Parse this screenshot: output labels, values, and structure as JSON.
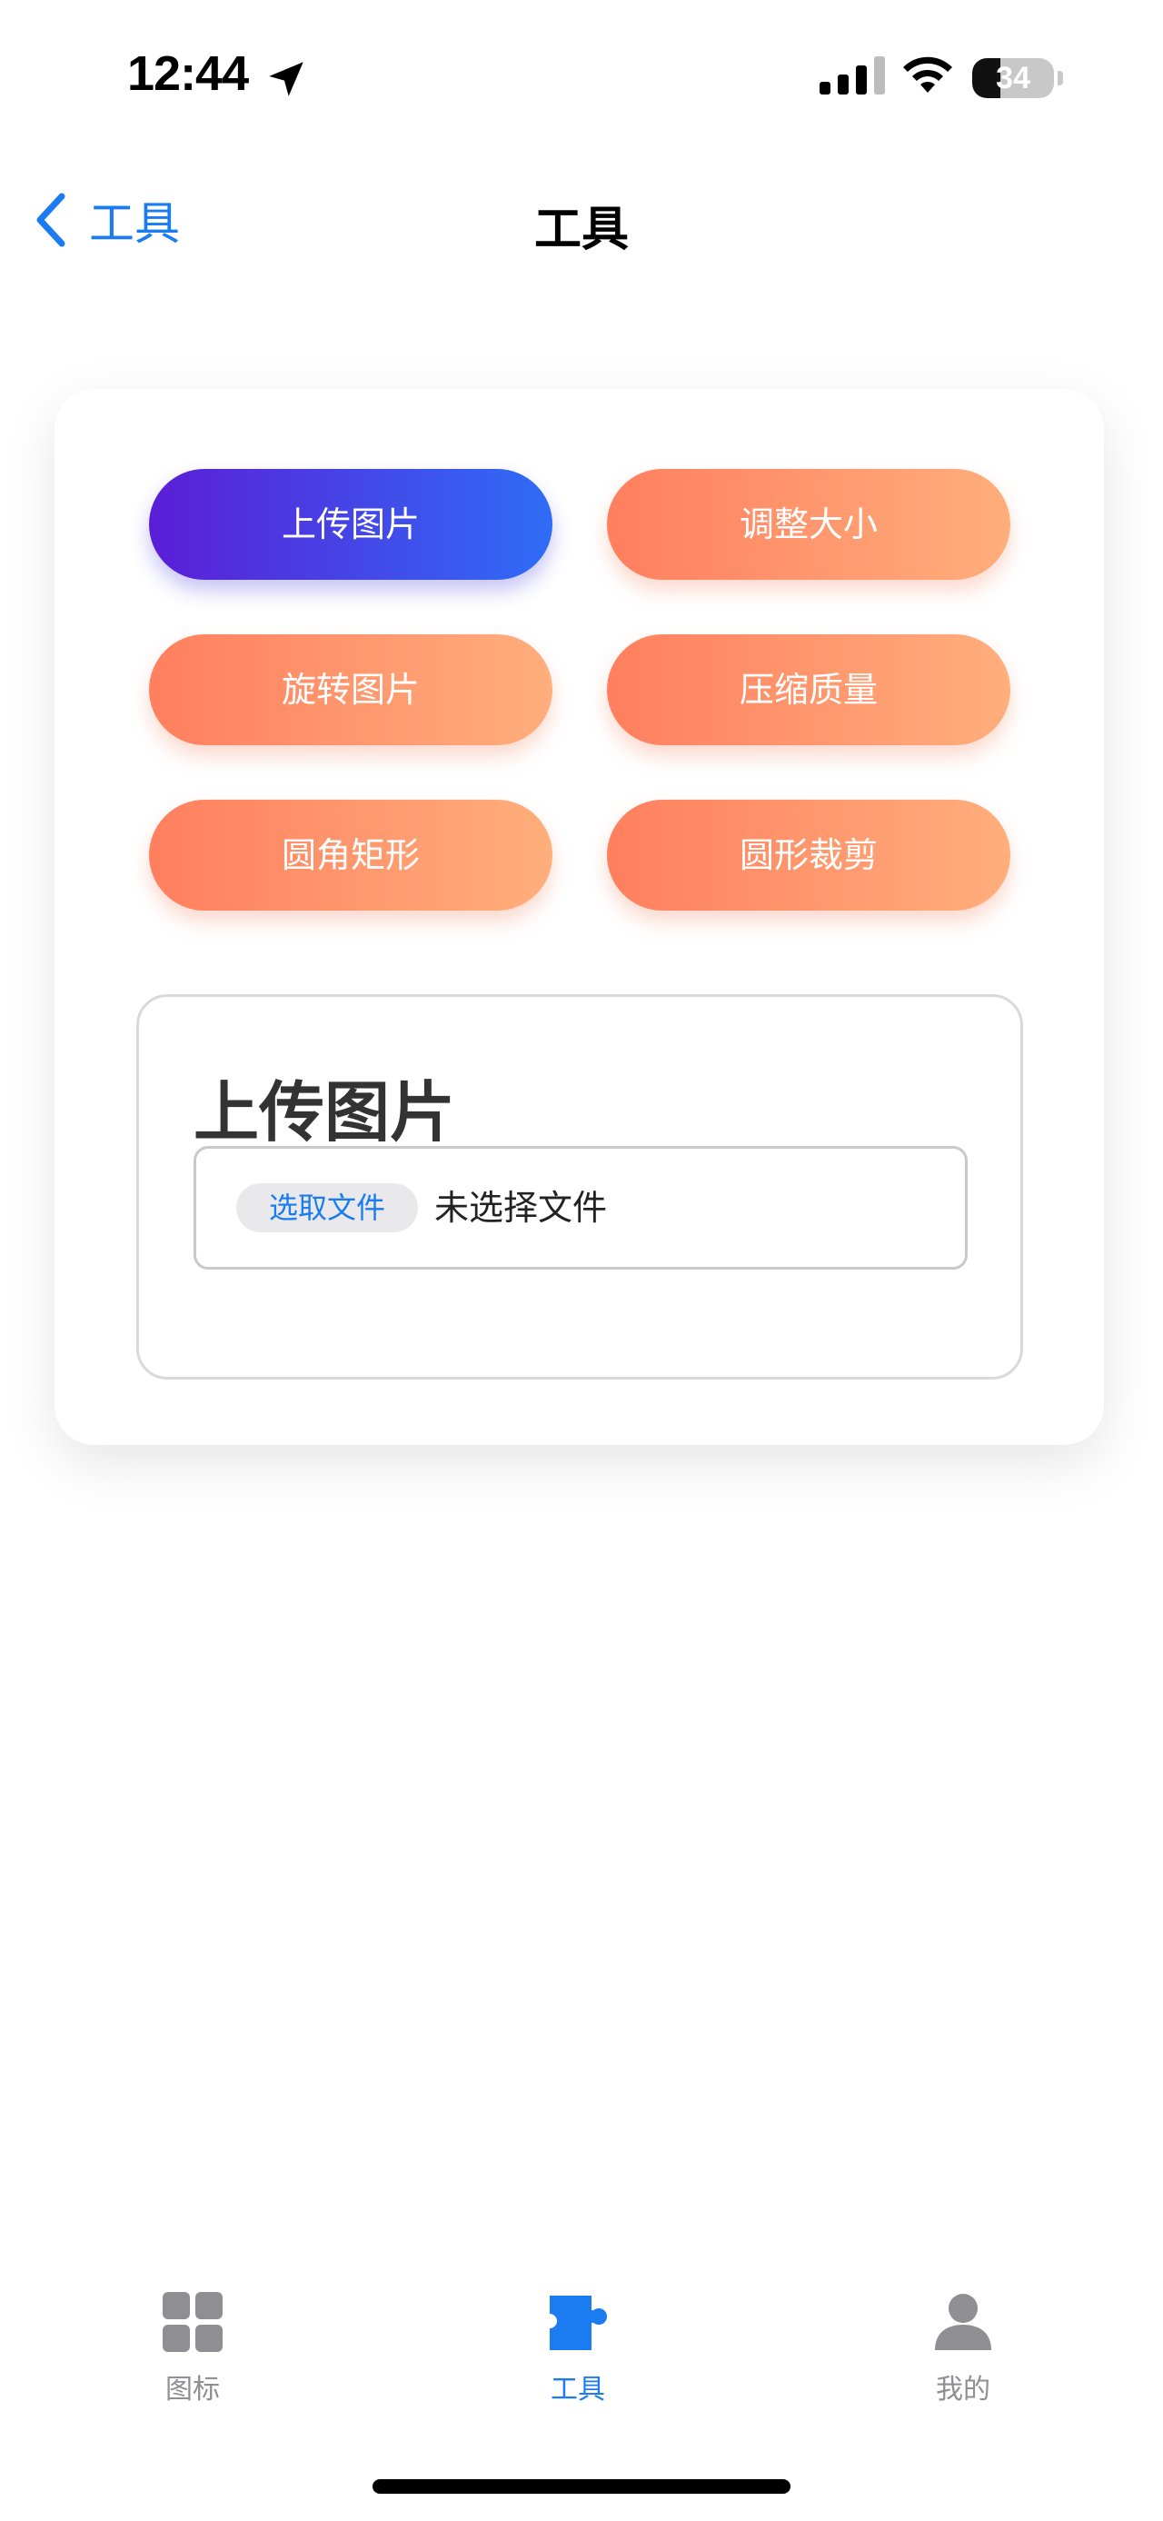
{
  "status_bar": {
    "time": "12:44",
    "battery": "34",
    "battery_level": 0.34,
    "icons": [
      "location-arrow-icon",
      "cellular-signal-icon",
      "wifi-icon",
      "battery-icon"
    ]
  },
  "nav": {
    "back_label": "工具",
    "title": "工具",
    "back_icon": "chevron-left-icon"
  },
  "tools": {
    "upload": "上传图片",
    "resize": "调整大小",
    "rotate": "旋转图片",
    "compress": "压缩质量",
    "rounded_rect": "圆角矩形",
    "circle_crop": "圆形裁剪"
  },
  "panel": {
    "heading": "上传图片",
    "choose_file": "选取文件",
    "no_file": "未选择文件"
  },
  "tab_bar": {
    "items": [
      {
        "label": "图标",
        "icon": "grid-icon",
        "active": false
      },
      {
        "label": "工具",
        "icon": "puzzle-icon",
        "active": true
      },
      {
        "label": "我的",
        "icon": "person-icon",
        "active": false
      }
    ]
  },
  "colors": {
    "accent": "#1a7cf0",
    "primary_gradient": [
      "#5b1ed6",
      "#2f6cf6"
    ],
    "secondary_gradient": [
      "#ff7f5e",
      "#ffae7c"
    ],
    "inactive_tab": "#8e8e93"
  }
}
